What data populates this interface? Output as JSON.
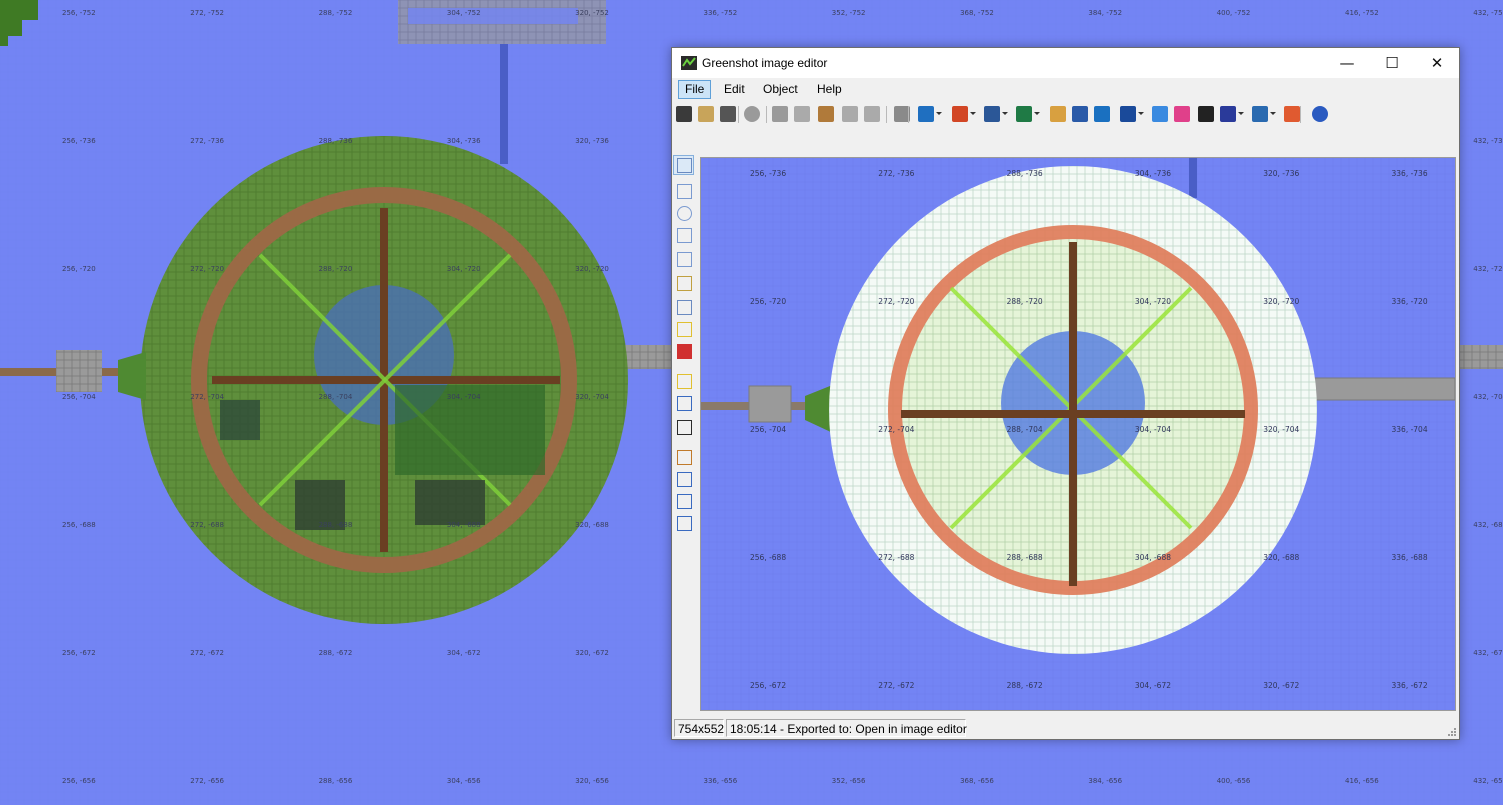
{
  "window": {
    "title": "Greenshot image editor",
    "minimize_glyph": "—",
    "maximize_glyph": "☐",
    "close_glyph": "✕"
  },
  "menu": {
    "items": [
      "File",
      "Edit",
      "Object",
      "Help"
    ],
    "active": "File"
  },
  "toolbar": {
    "icons": [
      "save-icon",
      "clipboard-icon",
      "print-icon",
      "delete-icon",
      "cut-icon",
      "copy-icon",
      "paste-icon",
      "undo-icon",
      "redo-icon",
      "settings-icon",
      "outlook-icon",
      "powerpoint-icon",
      "word-icon",
      "excel-icon",
      "paint-icon",
      "box-icon",
      "photobucket-icon",
      "jira-icon",
      "dropbox-icon",
      "flickr-icon",
      "imgur-icon",
      "lync-icon",
      "external-command-icon",
      "color-wheel-icon",
      "help-icon"
    ]
  },
  "tools": {
    "icons": [
      "select-cursor-icon",
      "rectangle-icon",
      "ellipse-icon",
      "line-icon",
      "arrow-icon",
      "freehand-icon",
      "text-icon",
      "speechbubble-icon",
      "counter-icon",
      "highlight-icon",
      "obfuscate-icon",
      "magic-icon",
      "crop-icon",
      "rotate-cw-icon",
      "rotate-ccw-icon",
      "resize-icon"
    ]
  },
  "status": {
    "dimensions": "754x552",
    "message": "18:05:14 - Exported to: Open in image editor"
  },
  "colors": {
    "water": "#7384f4",
    "grass": "#5a8a3a",
    "path": "#8a5a3a",
    "accent": "#cce4f7"
  },
  "map": {
    "xs": [
      "256",
      "272",
      "288",
      "304",
      "320",
      "336",
      "352",
      "368",
      "384",
      "400",
      "416",
      "432"
    ],
    "zs": [
      "-752",
      "-736",
      "-720",
      "-704",
      "-688",
      "-672",
      "-656"
    ]
  },
  "editor_map": {
    "xs": [
      "256",
      "272",
      "288",
      "304",
      "320",
      "336"
    ],
    "zs": [
      "-736",
      "-720",
      "-704",
      "-688",
      "-672"
    ]
  }
}
